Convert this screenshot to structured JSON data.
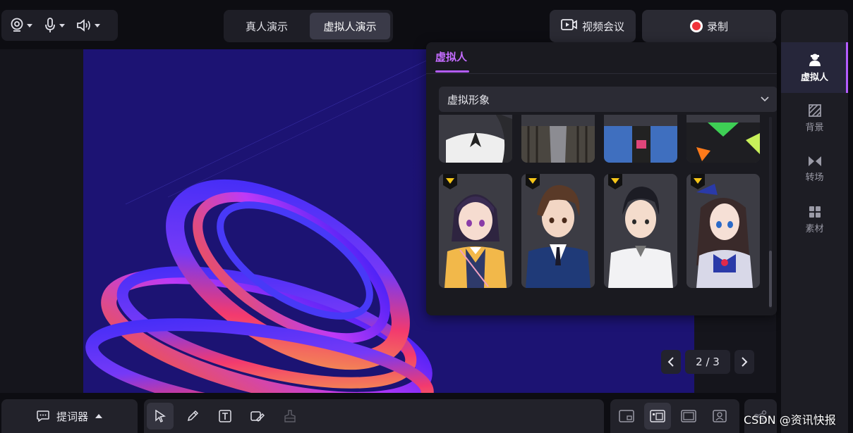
{
  "header": {
    "mode_tabs": [
      {
        "label": "真人演示",
        "active": false
      },
      {
        "label": "虚拟人演示",
        "active": true
      }
    ],
    "video_conf_label": "视频会议",
    "record_label": "录制"
  },
  "devices": [
    {
      "icon": "webcam-icon"
    },
    {
      "icon": "microphone-icon"
    },
    {
      "icon": "speaker-icon"
    }
  ],
  "panel": {
    "tab_label": "虚拟人",
    "dropdown_value": "虚拟形象",
    "avatars_partial": [
      "bow-blouse-girl",
      "striped-jacket",
      "blue-hoodie",
      "black-green-jacket"
    ],
    "avatars": [
      {
        "name": "purple-hair-schoolgirl",
        "premium": true
      },
      {
        "name": "brown-hair-blazer-boy",
        "premium": true
      },
      {
        "name": "black-hair-shirt-boy",
        "premium": true
      },
      {
        "name": "hat-dress-girl",
        "premium": true
      }
    ]
  },
  "pager": {
    "text": "2 / 3"
  },
  "sidebar": {
    "items": [
      {
        "label": "虚拟人",
        "icon": "avatar-icon",
        "active": true
      },
      {
        "label": "背景",
        "icon": "background-icon",
        "active": false
      },
      {
        "label": "转场",
        "icon": "transition-icon",
        "active": false
      },
      {
        "label": "素材",
        "icon": "assets-icon",
        "active": false
      }
    ]
  },
  "bottom": {
    "teleprompter_label": "提词器",
    "tools": [
      "select-tool-icon",
      "pen-tool-icon",
      "text-tool-icon",
      "eraser-tool-icon",
      "clear-tool-icon"
    ],
    "layouts": [
      "layout-pip-small-icon",
      "layout-pip-large-icon",
      "layout-screen-only-icon",
      "layout-person-only-icon"
    ]
  },
  "watermark": "CSDN @资讯快报",
  "colors": {
    "accent": "#b45cff",
    "record": "#f0323a",
    "premium_badge": "#f5c518"
  }
}
